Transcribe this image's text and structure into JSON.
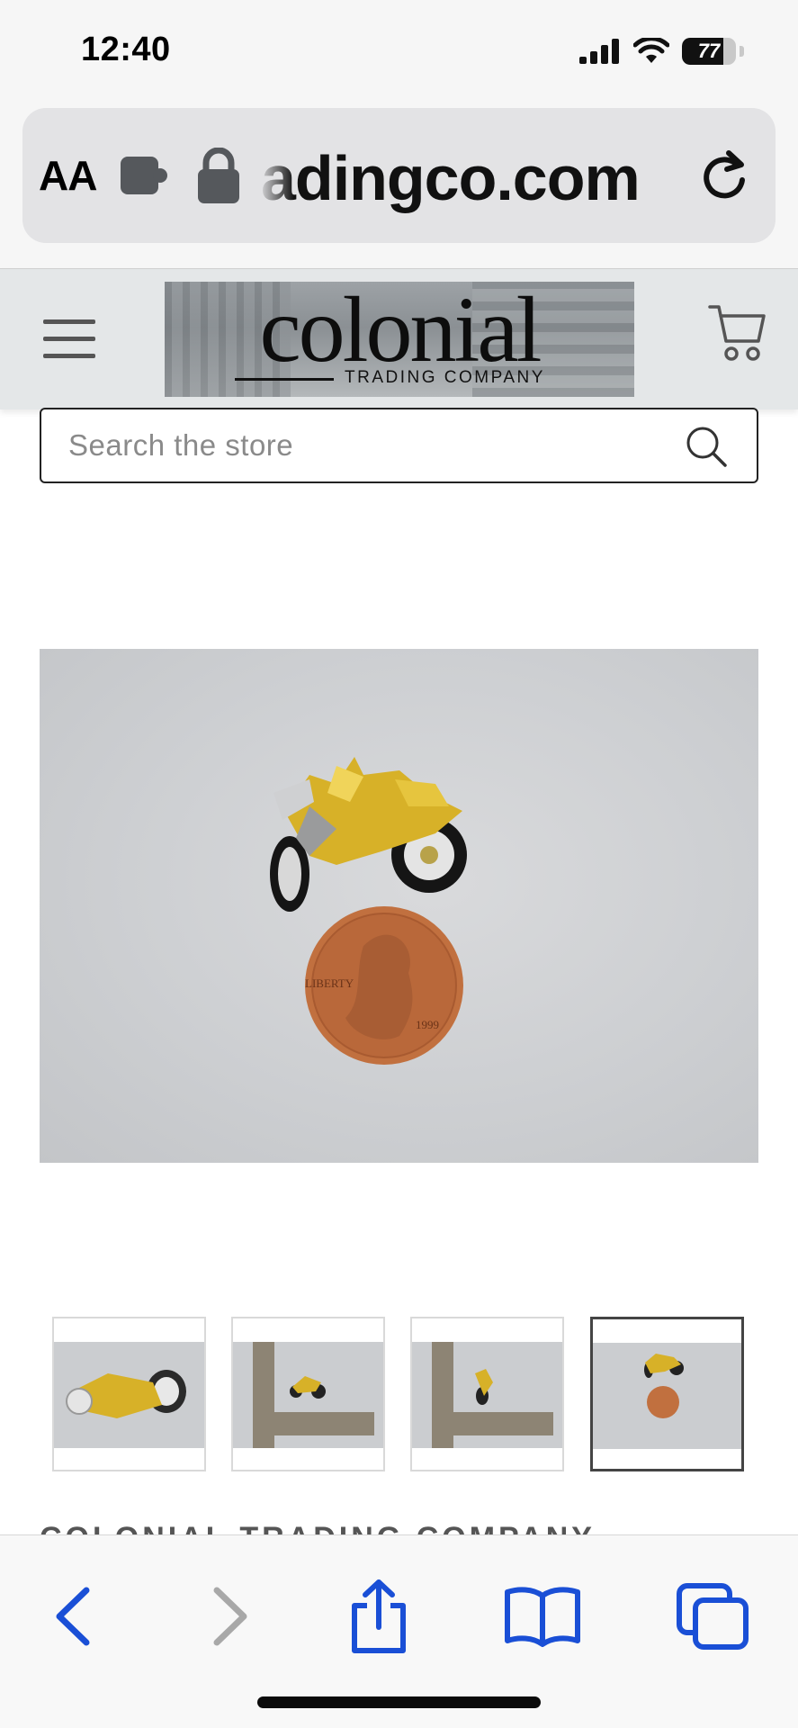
{
  "status_bar": {
    "time": "12:40",
    "battery_level": "77",
    "battery_fraction": 0.77,
    "icons": [
      "signal-icon",
      "wifi-icon",
      "battery-icon"
    ]
  },
  "address_bar": {
    "aa_label": "AA",
    "url": "adingco.com",
    "icons": [
      "extension-icon",
      "lock-icon",
      "reload-icon"
    ]
  },
  "header": {
    "logo_name": "colonial",
    "logo_subtitle": "TRADING COMPANY",
    "icons": [
      "hamburger-menu-icon",
      "cart-icon"
    ]
  },
  "search": {
    "placeholder": "Search the store",
    "value": ""
  },
  "product": {
    "main_image": "gold motorcycle charm next to a 1999 penny",
    "penny_year": "1999",
    "penny_motto": "LIBERTY",
    "thumbnails": [
      {
        "label": "charm side view"
      },
      {
        "label": "charm with ruler"
      },
      {
        "label": "charm with ruler angled"
      },
      {
        "label": "charm with penny",
        "active": true
      }
    ]
  },
  "below_text": "COLONIAL TRADING COMPANY",
  "toolbar": {
    "items": [
      "back",
      "forward",
      "share",
      "bookmarks",
      "tabs"
    ]
  },
  "colors": {
    "accent": "#1a4fd6",
    "disabled": "#a8a8a8",
    "header_bg": "#e4e7e8"
  }
}
